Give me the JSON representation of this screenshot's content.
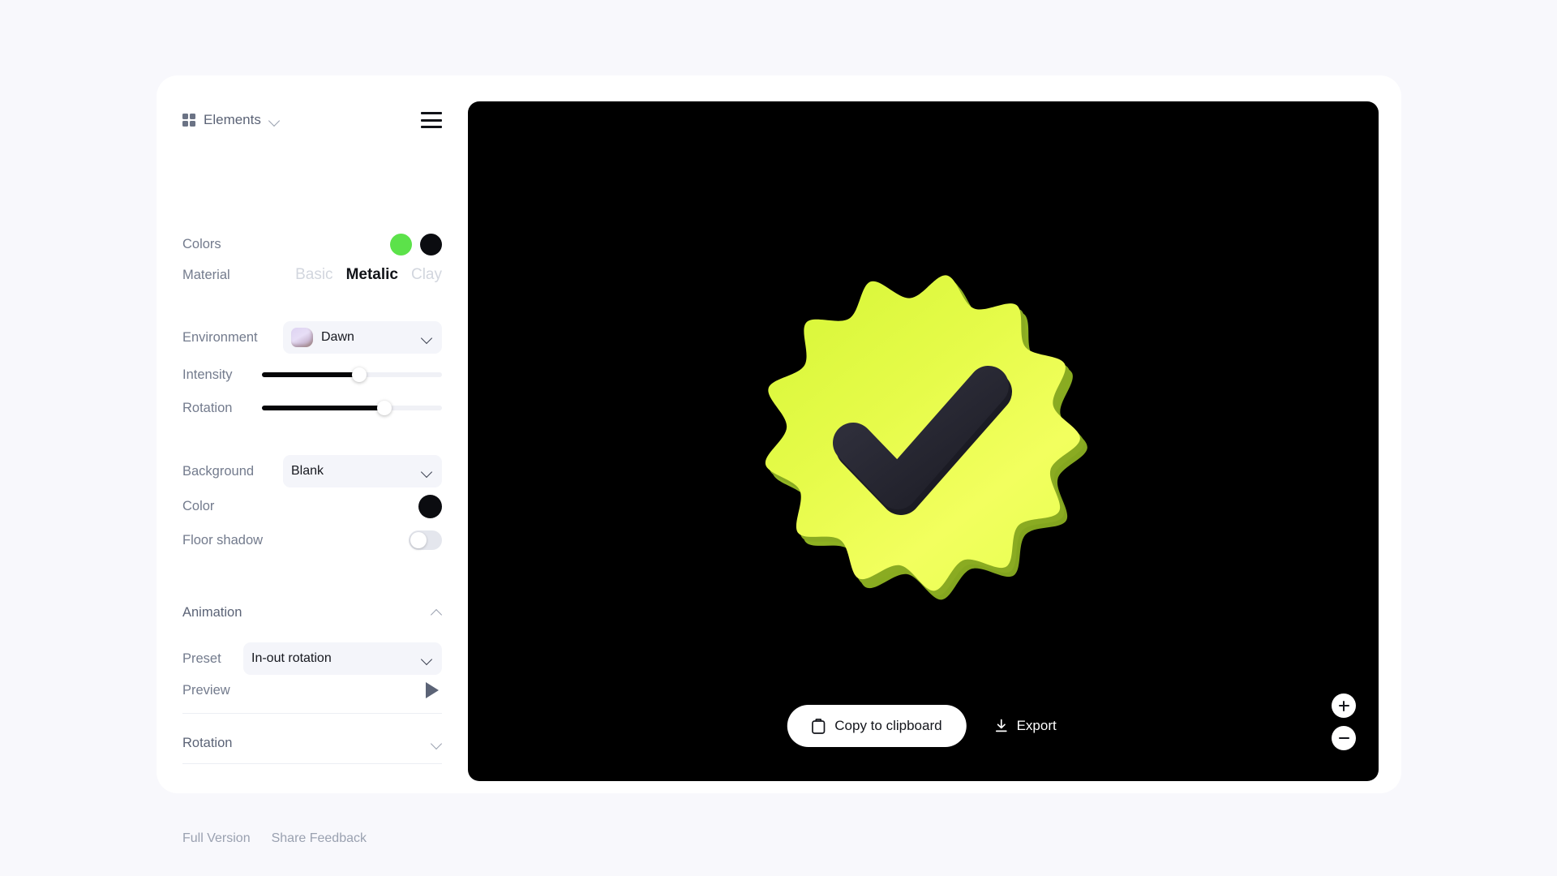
{
  "app": {
    "background_color": "#f8f8fc",
    "card_color": "#ffffff"
  },
  "sidebar": {
    "header": {
      "elements_label": "Elements",
      "grid_icon": "grid-icon",
      "chevron_icon": "chevron-down-icon",
      "menu_icon": "hamburger-menu-icon"
    },
    "colors": {
      "label": "Colors",
      "swatches": [
        {
          "name": "primary-color-swatch",
          "value": "#5ce24a"
        },
        {
          "name": "secondary-color-swatch",
          "value": "#0b0c10"
        }
      ]
    },
    "material": {
      "label": "Material",
      "options": [
        "Basic",
        "Metalic",
        "Clay"
      ],
      "selected": "Metalic"
    },
    "environment": {
      "label": "Environment",
      "value": "Dawn",
      "thumbnail": "dawn-environment-thumbnail",
      "chevron_icon": "chevron-down-icon"
    },
    "intensity": {
      "label": "Intensity",
      "value_percent": 54
    },
    "rotation_slider": {
      "label": "Rotation",
      "value_percent": 68
    },
    "background": {
      "label": "Background",
      "value": "Blank",
      "chevron_icon": "chevron-down-icon"
    },
    "background_color": {
      "label": "Color",
      "value": "#0b0c10"
    },
    "floor_shadow": {
      "label": "Floor shadow",
      "enabled": false
    },
    "animation": {
      "title": "Animation",
      "chevron_icon": "chevron-up-icon",
      "preset": {
        "label": "Preset",
        "value": "In-out rotation",
        "chevron_icon": "chevron-down-icon"
      },
      "preview": {
        "label": "Preview",
        "play_icon": "play-icon"
      }
    },
    "rotation_section": {
      "title": "Rotation",
      "chevron_icon": "chevron-down-icon"
    },
    "footer": {
      "links": [
        "Full Version",
        "Share Feedback"
      ]
    }
  },
  "canvas": {
    "background_color": "#000000",
    "object": {
      "name": "verified-badge-3d-object",
      "shape": "scalloped-badge-with-checkmark",
      "face_color": "#e2f73d",
      "face_color_light": "#eaff55",
      "side_color": "#8aab22",
      "check_color": "#24242e"
    },
    "toolbar": {
      "copy_label": "Copy to clipboard",
      "copy_icon": "clipboard-icon",
      "export_label": "Export",
      "export_icon": "download-icon"
    },
    "zoom_controls": {
      "zoom_in_icon": "plus-icon",
      "zoom_out_icon": "minus-icon"
    }
  }
}
